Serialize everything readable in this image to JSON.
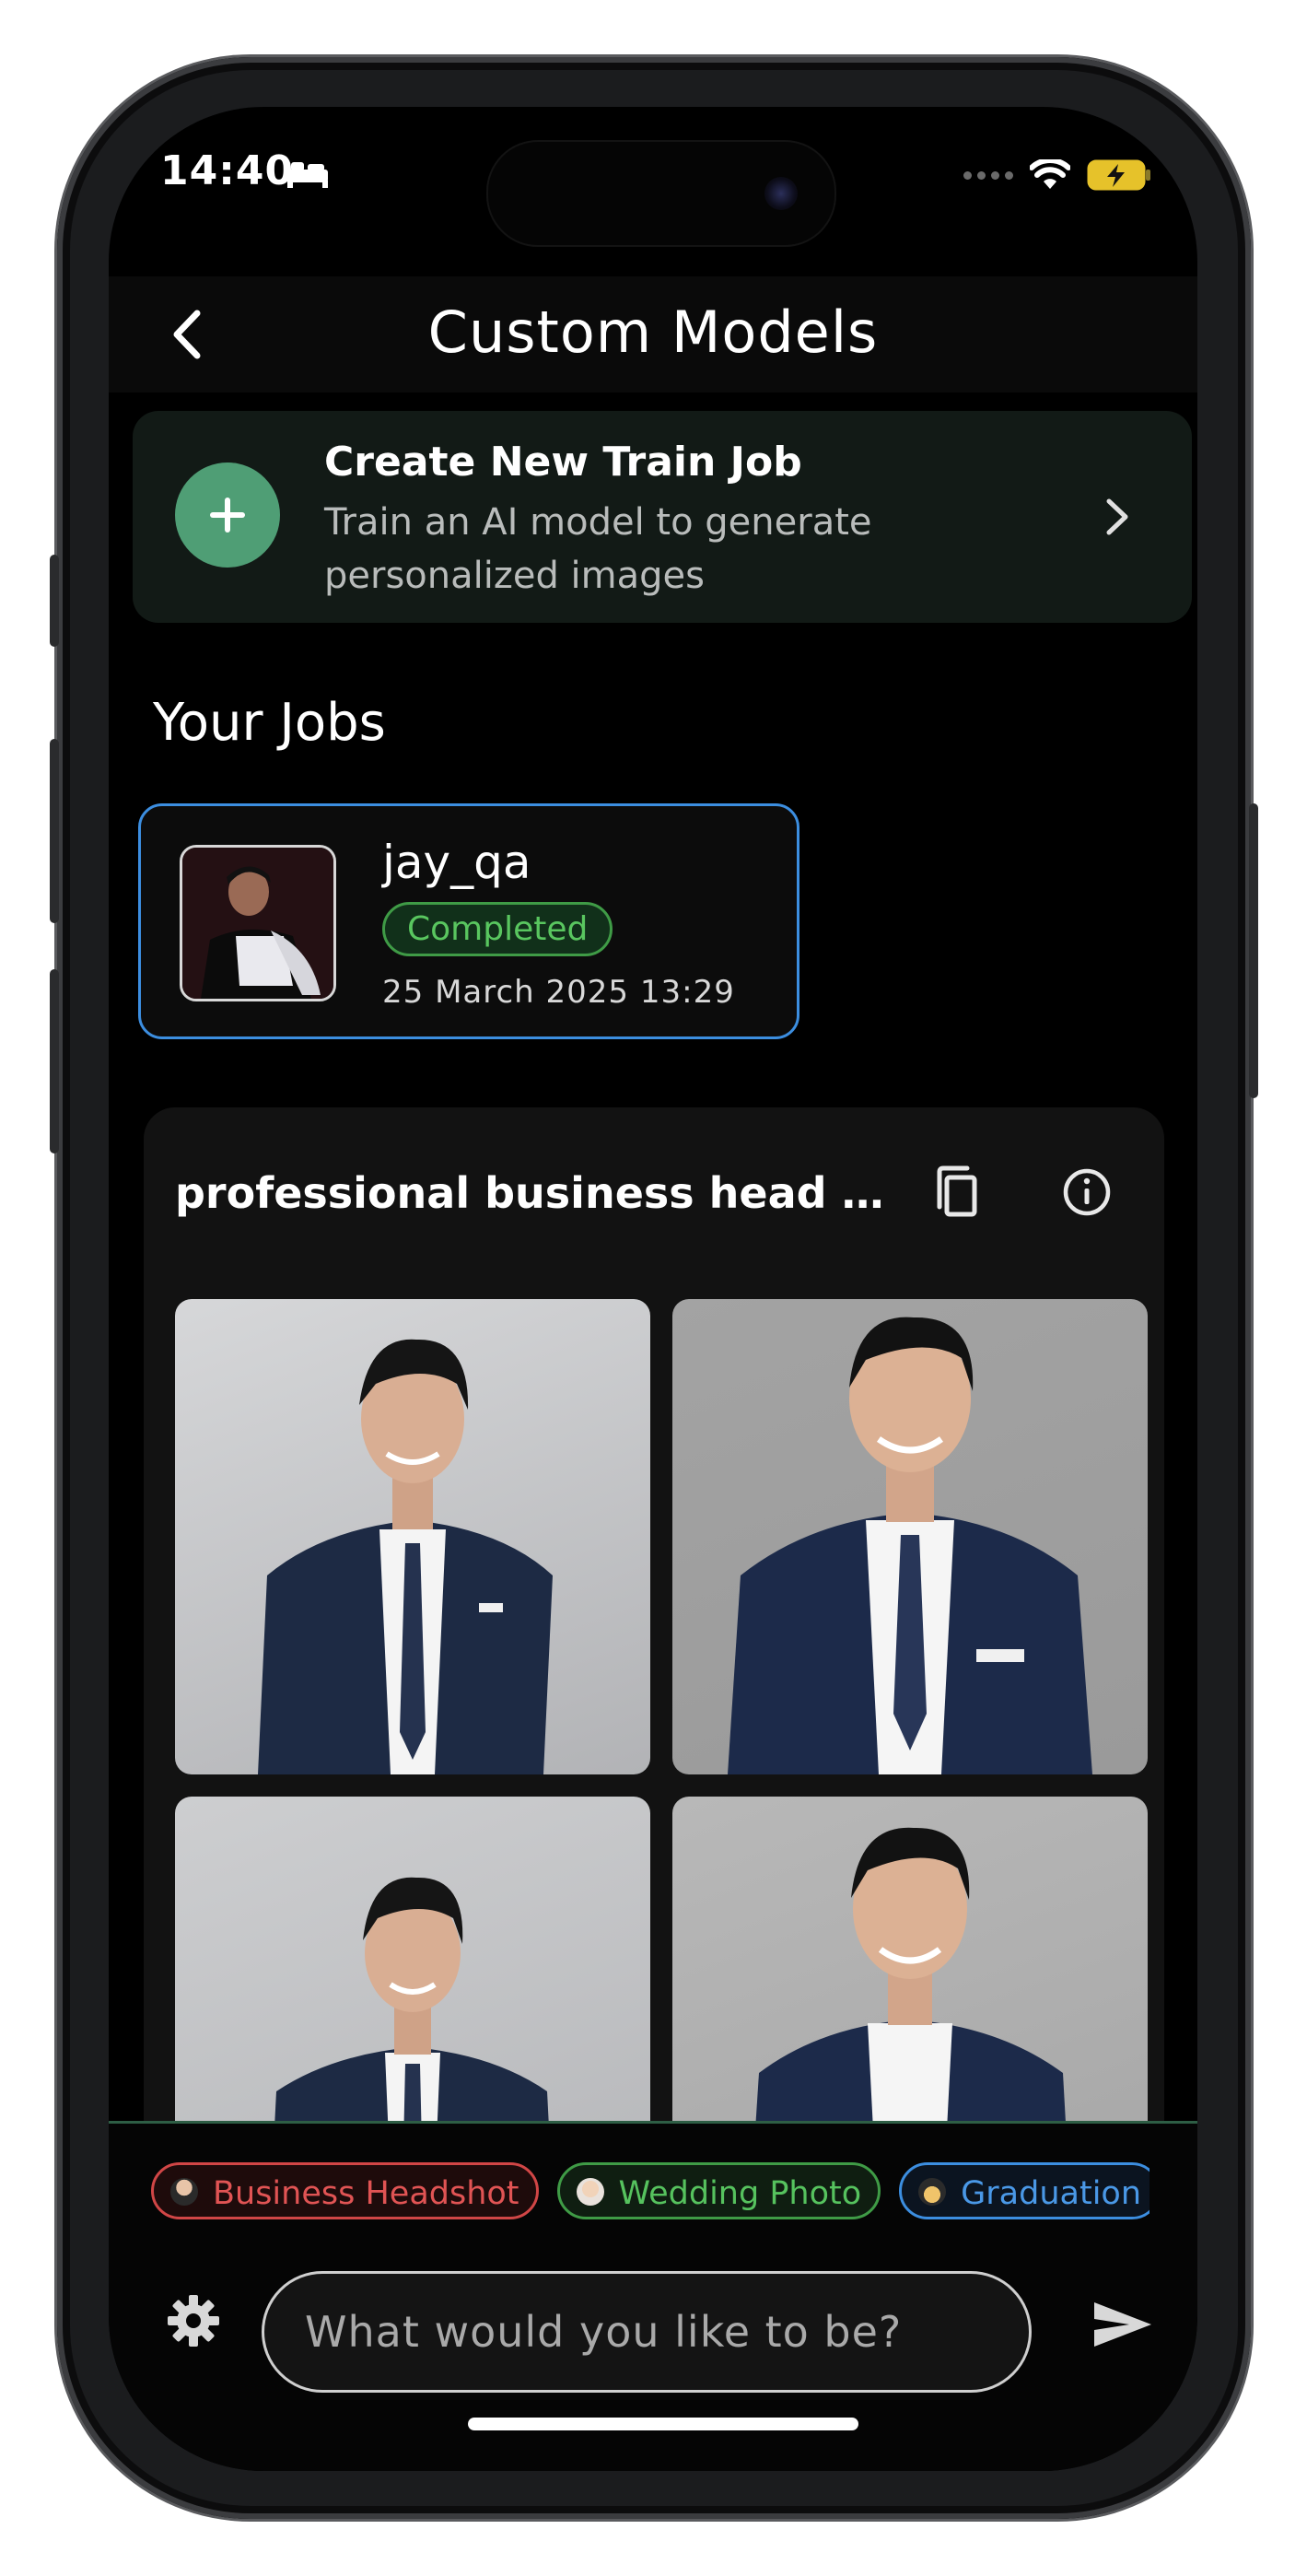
{
  "status_bar": {
    "time": "14:40"
  },
  "header": {
    "title": "Custom Models"
  },
  "create_job": {
    "title": "Create New Train Job",
    "subtitle": "Train an AI model to generate personalized images"
  },
  "jobs_section": {
    "title": "Your Jobs"
  },
  "jobs": [
    {
      "name": "jay_qa",
      "status": "Completed",
      "date": "25 March 2025 13:29"
    }
  ],
  "result": {
    "title": "professional business head sho..."
  },
  "chips": [
    {
      "label": "Business Headshot",
      "color": "#e05454"
    },
    {
      "label": "Wedding Photo",
      "color": "#56c25e"
    },
    {
      "label": "Graduation",
      "color": "#4a98e6"
    }
  ],
  "prompt": {
    "placeholder": "What would you like to be?"
  },
  "colors": {
    "accent_green": "#4f9e75",
    "selected_border": "#3c8ee0",
    "status_green": "#59c65f"
  }
}
